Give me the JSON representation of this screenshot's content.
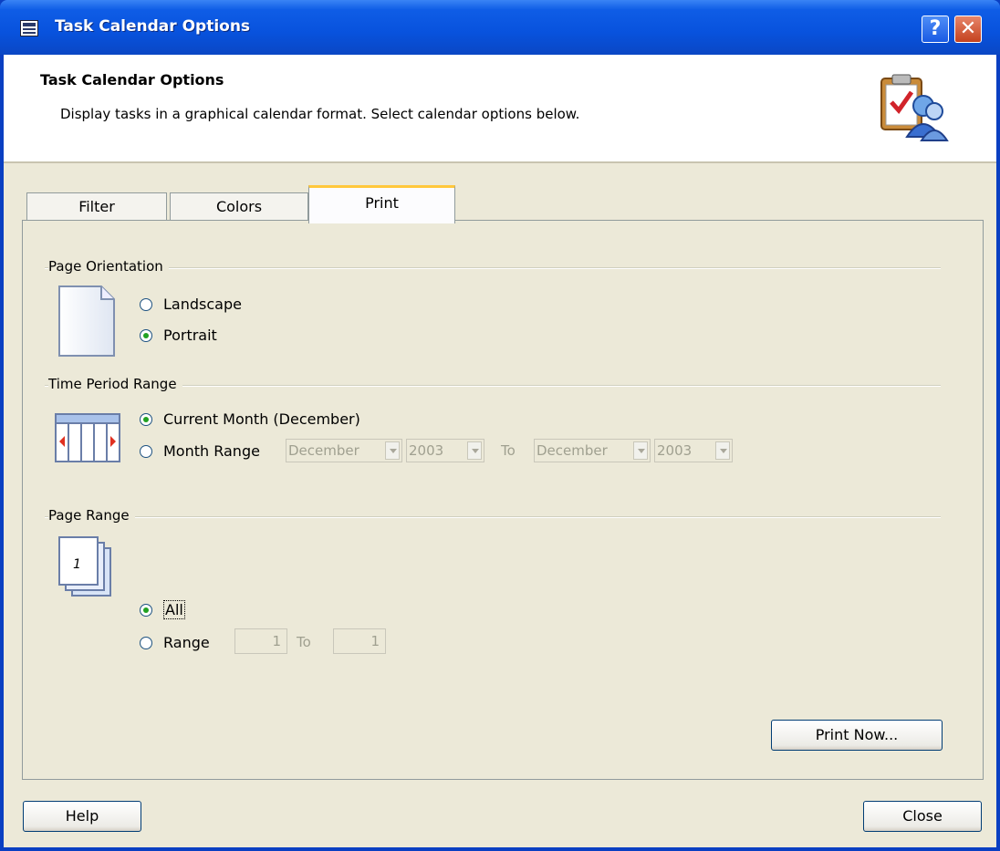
{
  "window": {
    "title": "Task Calendar Options"
  },
  "header": {
    "title": "Task Calendar Options",
    "description": "Display tasks in a graphical calendar format. Select calendar options below."
  },
  "tabs": [
    {
      "label": "Filter",
      "active": false
    },
    {
      "label": "Colors",
      "active": false
    },
    {
      "label": "Print",
      "active": true
    }
  ],
  "page_orientation": {
    "label": "Page Orientation",
    "options": [
      {
        "label": "Landscape",
        "checked": false
      },
      {
        "label": "Portrait",
        "checked": true
      }
    ]
  },
  "time_period": {
    "label": "Time Period Range",
    "current_month_label": "Current Month (December)",
    "month_range_label": "Month Range",
    "from_month": "December",
    "from_year": "2003",
    "to_label": "To",
    "to_month": "December",
    "to_year": "2003",
    "selected": "current_month"
  },
  "page_range": {
    "label": "Page Range",
    "all_label": "All",
    "range_label": "Range",
    "from": "1",
    "to_label": "To",
    "to": "1",
    "selected": "all",
    "icon_page_number": "1"
  },
  "buttons": {
    "print_now": "Print Now...",
    "help": "Help",
    "close": "Close"
  },
  "colors": {
    "titlebar": "#0852dd",
    "radio_check": "#21a121",
    "tab_highlight": "#ffc83c"
  }
}
